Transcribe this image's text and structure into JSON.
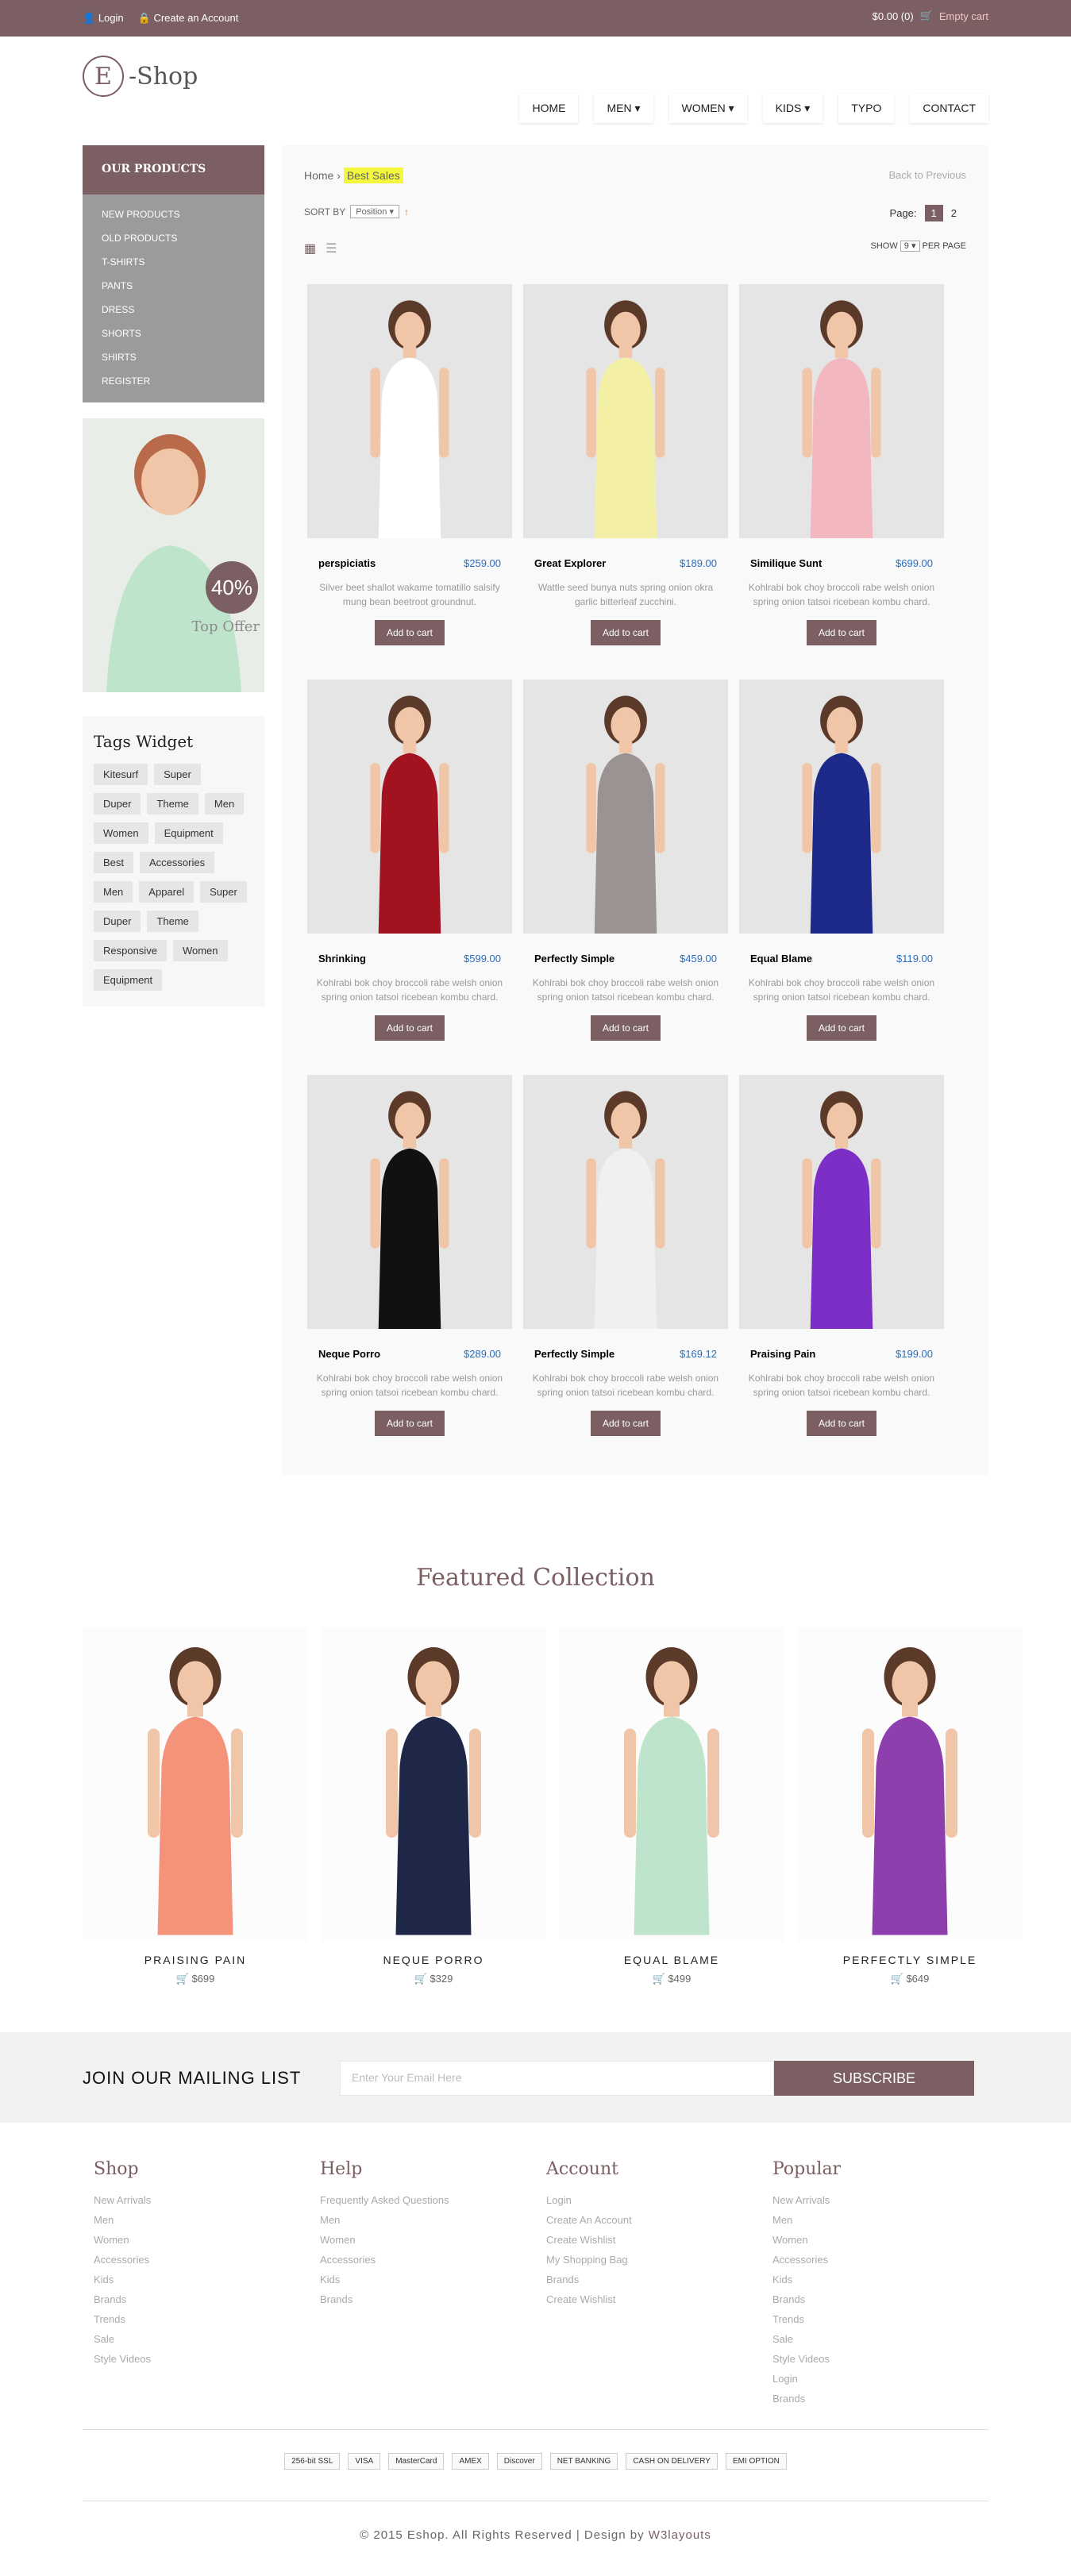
{
  "topbar": {
    "login": "Login",
    "create": "Create an Account",
    "cart_total": "$0.00 (0)",
    "cart_label": "Empty cart"
  },
  "logo": {
    "letter": "E",
    "text": "-Shop"
  },
  "nav": [
    "HOME",
    "MEN ▾",
    "WOMEN ▾",
    "KIDS ▾",
    "TYPO",
    "CONTACT"
  ],
  "sidebar": {
    "title": "OUR PRODUCTS",
    "items": [
      "NEW PRODUCTS",
      "OLD PRODUCTS",
      "T-SHIRTS",
      "PANTS",
      "DRESS",
      "SHORTS",
      "SHIRTS",
      "REGISTER"
    ],
    "promo_pct": "40%",
    "promo_label": "Top Offer"
  },
  "tags": {
    "title": "Tags Widget",
    "items": [
      "Kitesurf",
      "Super",
      "Duper",
      "Theme",
      "Men",
      "Women",
      "Equipment",
      "Best",
      "Accessories",
      "Men",
      "Apparel",
      "Super",
      "Duper",
      "Theme",
      "Responsive",
      "Women",
      "Equipment"
    ]
  },
  "main": {
    "home": "Home",
    "sep": " › ",
    "crumb": "Best Sales",
    "back": "Back to Previous",
    "sort_label": "SORT BY",
    "sort_value": "Position ▾",
    "page_label": "Page:",
    "page1": "1",
    "page2": "2",
    "show_label": "SHOW",
    "show_value": "9 ▾",
    "per_page": "PER PAGE"
  },
  "products": [
    {
      "name": "perspiciatis",
      "price": "$259.00",
      "desc": "Silver beet shallot wakame tomatillo salsify mung bean beetroot groundnut.",
      "btn": "Add to cart",
      "bg": "#e3e3e3",
      "dress": "#ffffff"
    },
    {
      "name": "Great Explorer",
      "price": "$189.00",
      "desc": "Wattle seed bunya nuts spring onion okra garlic bitterleaf zucchini.",
      "btn": "Add to cart",
      "bg": "#e3e3e3",
      "dress": "#f3f0a6"
    },
    {
      "name": "Similique Sunt",
      "price": "$699.00",
      "desc": "Kohlrabi bok choy broccoli rabe welsh onion spring onion tatsoi ricebean kombu chard.",
      "btn": "Add to cart",
      "bg": "#e3e3e3",
      "dress": "#f3b7c0"
    },
    {
      "name": "Shrinking",
      "price": "$599.00",
      "desc": "Kohlrabi bok choy broccoli rabe welsh onion spring onion tatsoi ricebean kombu chard.",
      "btn": "Add to cart",
      "bg": "#e3e3e3",
      "dress": "#a3131f"
    },
    {
      "name": "Perfectly Simple",
      "price": "$459.00",
      "desc": "Kohlrabi bok choy broccoli rabe welsh onion spring onion tatsoi ricebean kombu chard.",
      "btn": "Add to cart",
      "bg": "#e3e3e3",
      "dress": "#9a9391"
    },
    {
      "name": "Equal Blame",
      "price": "$119.00",
      "desc": "Kohlrabi bok choy broccoli rabe welsh onion spring onion tatsoi ricebean kombu chard.",
      "btn": "Add to cart",
      "bg": "#e3e3e3",
      "dress": "#1e2a8a"
    },
    {
      "name": "Neque Porro",
      "price": "$289.00",
      "desc": "Kohlrabi bok choy broccoli rabe welsh onion spring onion tatsoi ricebean kombu chard.",
      "btn": "Add to cart",
      "bg": "#e3e3e3",
      "dress": "#111111"
    },
    {
      "name": "Perfectly Simple",
      "price": "$169.12",
      "desc": "Kohlrabi bok choy broccoli rabe welsh onion spring onion tatsoi ricebean kombu chard.",
      "btn": "Add to cart",
      "bg": "#e3e3e3",
      "dress": "#f0f0f0"
    },
    {
      "name": "Praising Pain",
      "price": "$199.00",
      "desc": "Kohlrabi bok choy broccoli rabe welsh onion spring onion tatsoi ricebean kombu chard.",
      "btn": "Add to cart",
      "bg": "#e3e3e3",
      "dress": "#7b2fc6"
    }
  ],
  "featured": {
    "title": "Featured Collection",
    "items": [
      {
        "name": "PRAISING PAIN",
        "price": "$699",
        "dress": "#f4937a"
      },
      {
        "name": "NEQUE PORRO",
        "price": "$329",
        "dress": "#1f2749"
      },
      {
        "name": "EQUAL BLAME",
        "price": "$499",
        "dress": "#bfe4cc"
      },
      {
        "name": "PERFECTLY SIMPLE",
        "price": "$649",
        "dress": "#8d3fae"
      }
    ]
  },
  "mailing": {
    "label": "JOIN OUR MAILING LIST",
    "placeholder": "Enter Your Email Here",
    "button": "SUBSCRIBE"
  },
  "footer": [
    {
      "title": "Shop",
      "links": [
        "New Arrivals",
        "Men",
        "Women",
        "Accessories",
        "Kids",
        "Brands",
        "Trends",
        "Sale",
        "Style Videos"
      ]
    },
    {
      "title": "Help",
      "links": [
        "Frequently Asked Questions",
        "Men",
        "Women",
        "Accessories",
        "Kids",
        "Brands"
      ]
    },
    {
      "title": "Account",
      "links": [
        "Login",
        "Create An Account",
        "Create Wishlist",
        "My Shopping Bag",
        "Brands",
        "Create Wishlist"
      ]
    },
    {
      "title": "Popular",
      "links": [
        "New Arrivals",
        "Men",
        "Women",
        "Accessories",
        "Kids",
        "Brands",
        "Trends",
        "Sale",
        "Style Videos",
        "Login",
        "Brands"
      ]
    }
  ],
  "payments": [
    "256-bit SSL",
    "VISA",
    "MasterCard",
    "AMEX",
    "Discover",
    "NET BANKING",
    "CASH ON DELIVERY",
    "EMI OPTION"
  ],
  "copyright": {
    "text": "© 2015 Eshop. All Rights Reserved | Design by ",
    "author": "W3layouts"
  }
}
